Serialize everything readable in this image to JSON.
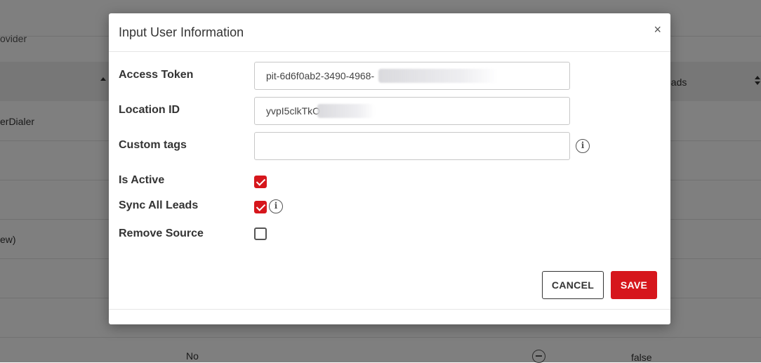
{
  "background": {
    "provider_fragment": "ovider",
    "leads_header_fragment": "eads",
    "row_fragment_1": "erDialer",
    "row_fragment_2": "ew)",
    "bottom_value_1": "No",
    "bottom_value_2": "false"
  },
  "modal": {
    "title": "Input User Information",
    "close_icon": "×",
    "fields": {
      "access_token": {
        "label": "Access Token",
        "value": "pit-6d6f0ab2-3490-4968-"
      },
      "location_id": {
        "label": "Location ID",
        "value": "yvpI5clkTkO"
      },
      "custom_tags": {
        "label": "Custom tags",
        "value": "",
        "placeholder": ""
      },
      "is_active": {
        "label": "Is Active",
        "checked": true
      },
      "sync_all_leads": {
        "label": "Sync All Leads",
        "checked": true
      },
      "remove_source": {
        "label": "Remove Source",
        "checked": false
      }
    },
    "info_icon_glyph": "i",
    "buttons": {
      "cancel": "CANCEL",
      "save": "SAVE"
    }
  },
  "colors": {
    "accent": "#d6161c",
    "overlay": "rgba(0,0,0,0.5)"
  },
  "icons": [
    "close-icon",
    "info-icon",
    "checkmark-icon",
    "sort-icon",
    "minus-circle-icon"
  ]
}
